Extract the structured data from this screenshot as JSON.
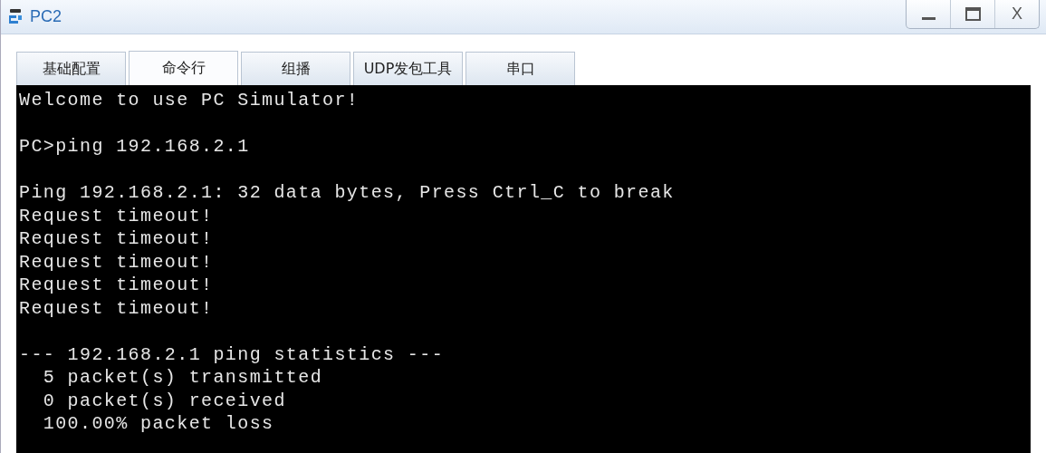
{
  "window": {
    "title": "PC2"
  },
  "title_buttons": [
    {
      "kind": "minimize"
    },
    {
      "kind": "maximize"
    },
    {
      "kind": "close",
      "label": "X"
    }
  ],
  "tabs": [
    {
      "label": "基础配置",
      "selected": false
    },
    {
      "label": "命令行",
      "selected": true
    },
    {
      "label": "组播",
      "selected": false
    },
    {
      "label": "UDP发包工具",
      "selected": false
    },
    {
      "label": "串口",
      "selected": false
    }
  ],
  "terminal": {
    "blocks": [
      [
        "Welcome to use PC Simulator!"
      ],
      [
        "PC>ping 192.168.2.1"
      ],
      [
        "Ping 192.168.2.1: 32 data bytes, Press Ctrl_C to break",
        "Request timeout!",
        "Request timeout!",
        "Request timeout!",
        "Request timeout!",
        "Request timeout!"
      ],
      [
        "--- 192.168.2.1 ping statistics ---",
        "  5 packet(s) transmitted",
        "  0 packet(s) received",
        "  100.00% packet loss"
      ]
    ]
  }
}
